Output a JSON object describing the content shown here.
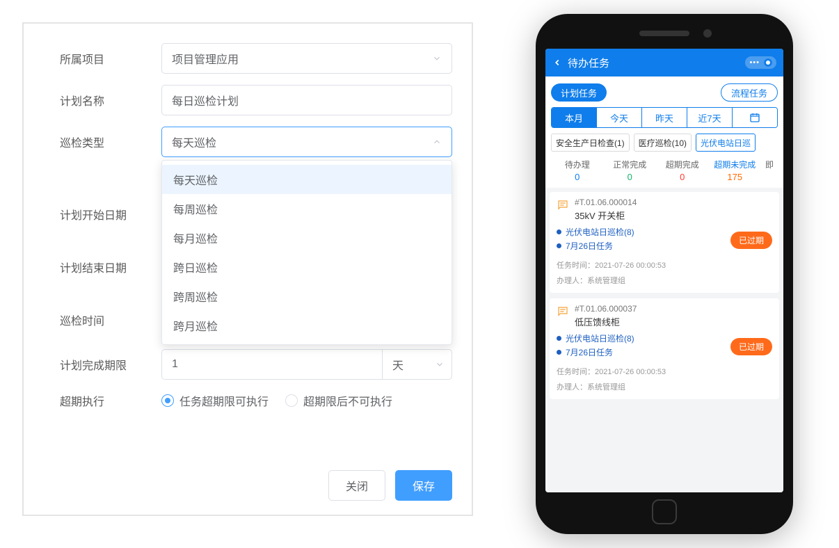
{
  "form": {
    "rows": {
      "project": {
        "label": "所属项目",
        "value": "项目管理应用"
      },
      "planName": {
        "label": "计划名称",
        "value": "每日巡检计划"
      },
      "inspectType": {
        "label": "巡检类型",
        "value": "每天巡检",
        "options": [
          "每天巡检",
          "每周巡检",
          "每月巡检",
          "跨日巡检",
          "跨周巡检",
          "跨月巡检"
        ]
      },
      "startDate": {
        "label": "计划开始日期"
      },
      "endDate": {
        "label": "计划结束日期"
      },
      "inspectTime": {
        "label": "巡检时间"
      },
      "deadline": {
        "label": "计划完成期限",
        "value": "1",
        "unit": "天"
      },
      "overdue": {
        "label": "超期执行",
        "opts": [
          "任务超期限可执行",
          "超期限后不可执行"
        ],
        "checked": 0
      }
    },
    "buttons": {
      "close": "关闭",
      "save": "保存"
    }
  },
  "phone": {
    "header": {
      "title": "待办任务"
    },
    "pills": {
      "left": "计划任务",
      "right": "流程任务"
    },
    "segments": [
      "本月",
      "今天",
      "昨天",
      "近7天"
    ],
    "seg_active": 0,
    "tags": [
      "安全生产日检查(1)",
      "医疗巡检(10)",
      "光伏电站日巡"
    ],
    "tag_active": 2,
    "stats": [
      {
        "label": "待办理",
        "value": "0"
      },
      {
        "label": "正常完成",
        "value": "0"
      },
      {
        "label": "超期完成",
        "value": "0"
      },
      {
        "label": "超期未完成",
        "value": "175"
      },
      {
        "label": "即",
        "value": ""
      }
    ],
    "cards": [
      {
        "no": "#T.01.06.000014",
        "name": "35kV 开关柜",
        "bullets": [
          "光伏电站日巡检(8)",
          "7月26日任务"
        ],
        "badge": "已过期",
        "time_label": "任务时间：",
        "time": "2021-07-26 00:00:53",
        "handler_label": "办理人：",
        "handler": "系统管理组"
      },
      {
        "no": "#T.01.06.000037",
        "name": "低压馈线柜",
        "bullets": [
          "光伏电站日巡检(8)",
          "7月26日任务"
        ],
        "badge": "已过期",
        "time_label": "任务时间：",
        "time": "2021-07-26 00:00:53",
        "handler_label": "办理人：",
        "handler": "系统管理组"
      }
    ]
  }
}
